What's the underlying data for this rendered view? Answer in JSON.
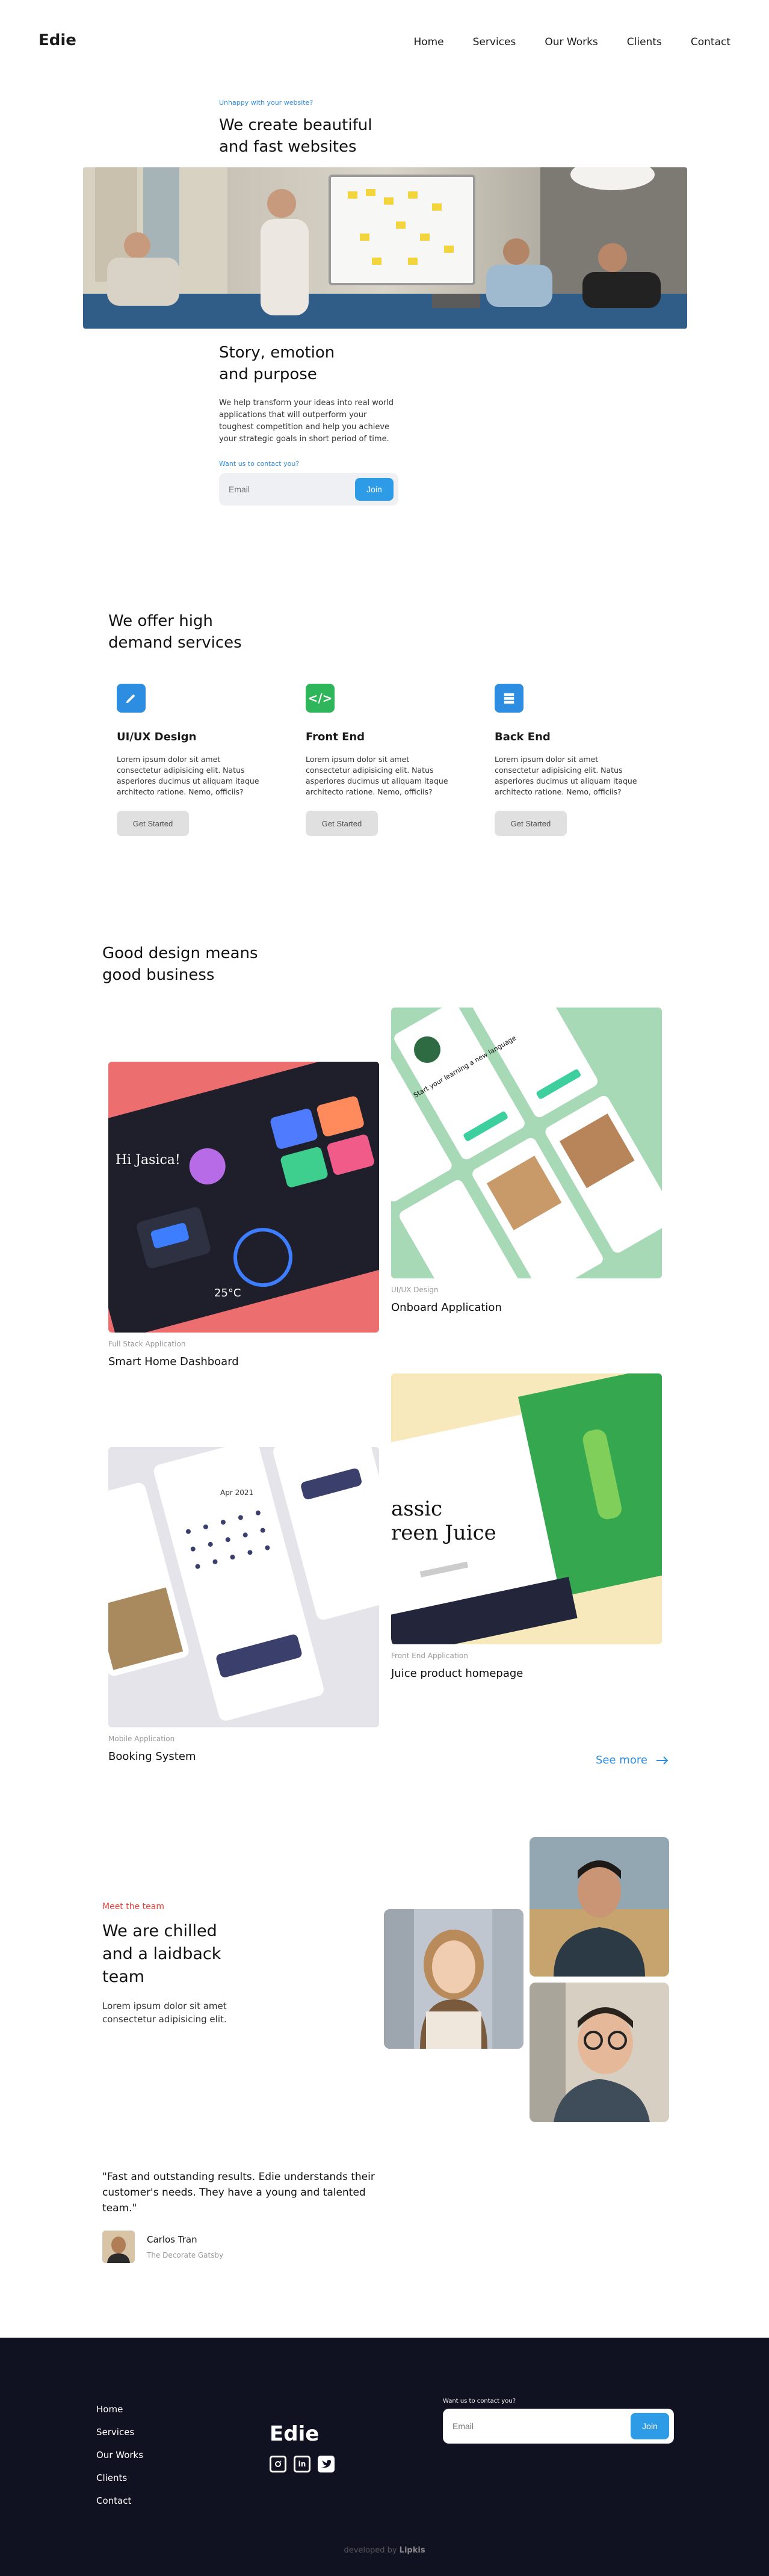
{
  "header": {
    "logo": "Edie",
    "nav": [
      "Home",
      "Services",
      "Our Works",
      "Clients",
      "Contact"
    ]
  },
  "hero": {
    "eyebrow": "Unhappy with your website?",
    "title_line1": "We create beautiful",
    "title_line2": "and fast websites",
    "story_line1": "Story, emotion",
    "story_line2": "and purpose",
    "body": "We help transform your ideas into real world applications that will outperform your toughest competition and help you achieve your strategic goals in short period of time.",
    "contact_eyebrow": "Want us to contact you?",
    "email_placeholder": "Email",
    "join_label": "Join"
  },
  "services": {
    "title_line1": "We offer high",
    "title_line2": "demand services",
    "items": [
      {
        "name": "UI/UX Design",
        "icon": "pencil-icon",
        "color": "#2d8de0",
        "desc": "Lorem ipsum dolor sit amet consectetur adipisicing elit. Natus asperiores ducimus ut aliquam itaque architecto ratione. Nemo, officiis?",
        "button": "Get Started"
      },
      {
        "name": "Front End",
        "icon": "code-icon",
        "color": "#2fb55a",
        "desc": "Lorem ipsum dolor sit amet consectetur adipisicing elit. Natus asperiores ducimus ut aliquam itaque architecto ratione. Nemo, officiis?",
        "button": "Get Started"
      },
      {
        "name": "Back End",
        "icon": "server-icon",
        "color": "#2d8de0",
        "desc": "Lorem ipsum dolor sit amet consectetur adipisicing elit. Natus asperiores ducimus ut aliquam itaque architecto ratione. Nemo, officiis?",
        "button": "Get Started"
      }
    ]
  },
  "works": {
    "title_line1": "Good design means",
    "title_line2": "good business",
    "items": [
      {
        "category": "Full Stack Application",
        "title": "Smart Home Dashboard"
      },
      {
        "category": "UI/UX Design",
        "title": "Onboard Application"
      },
      {
        "category": "Mobile Application",
        "title": "Booking System"
      },
      {
        "category": "Front End Application",
        "title": "Juice product homepage"
      }
    ],
    "see_more": "See more",
    "mock": {
      "dash_greeting": "Hi Jasica!",
      "dash_temp": "25°C",
      "onboard_text": "Start your learning a new language",
      "booking_month": "Apr 2021",
      "juice_line1": "assic",
      "juice_line2": "reen Juice"
    }
  },
  "team": {
    "eyebrow": "Meet the team",
    "title_line1": "We are chilled",
    "title_line2": "and a laidback",
    "title_line3": "team",
    "body": "Lorem ipsum dolor sit amet consectetur adipisicing elit."
  },
  "testimonial": {
    "quote": "\"Fast and outstanding results. Edie understands their customer's needs. They have a young and talented team.\"",
    "name": "Carlos Tran",
    "company": "The Decorate Gatsby"
  },
  "footer": {
    "nav": [
      "Home",
      "Services",
      "Our Works",
      "Clients",
      "Contact"
    ],
    "logo": "Edie",
    "contact_eyebrow": "Want us to contact you?",
    "email_placeholder": "Email",
    "join_label": "Join",
    "credit_prefix": "developed by",
    "credit_name": "Lipkis",
    "social_icons": [
      "instagram-icon",
      "linkedin-icon",
      "twitter-icon"
    ]
  },
  "colors": {
    "accent": "#2d9be6",
    "green": "#2fb55a",
    "team_eyebrow": "#e8423b",
    "footer_bg": "#111221"
  }
}
